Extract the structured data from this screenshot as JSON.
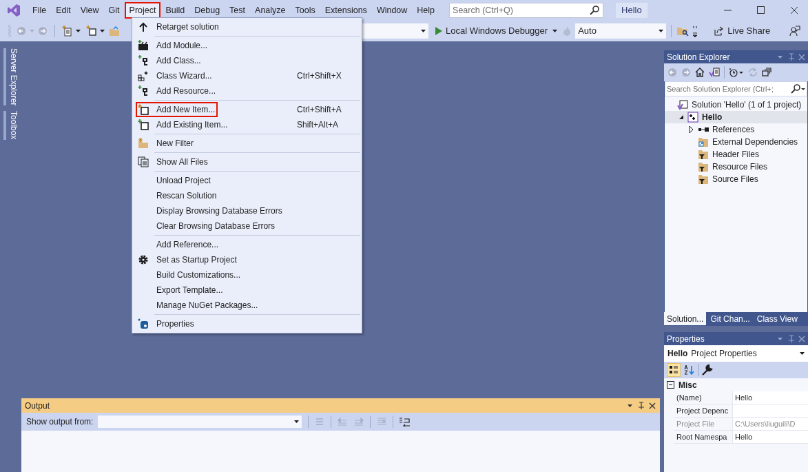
{
  "menu_bar": [
    {
      "label": "File",
      "selected": false
    },
    {
      "label": "Edit",
      "selected": false
    },
    {
      "label": "View",
      "selected": false
    },
    {
      "label": "Git",
      "selected": false
    },
    {
      "label": "Project",
      "selected": true
    },
    {
      "label": "Build",
      "selected": false
    },
    {
      "label": "Debug",
      "selected": false
    },
    {
      "label": "Test",
      "selected": false
    },
    {
      "label": "Analyze",
      "selected": false
    },
    {
      "label": "Tools",
      "selected": false
    },
    {
      "label": "Extensions",
      "selected": false
    },
    {
      "label": "Window",
      "selected": false
    },
    {
      "label": "Help",
      "selected": false
    }
  ],
  "search": {
    "placeholder": "Search (Ctrl+Q)"
  },
  "solution_badge": "Hello",
  "toolbar": {
    "debugger": "Local Windows Debugger",
    "configuration": "Auto",
    "live_share": "Live Share"
  },
  "side_tabs": [
    "Server Explorer",
    "Toolbox"
  ],
  "project_menu": {
    "groups": [
      [
        {
          "label": "Retarget solution",
          "outlined": false
        }
      ],
      [
        {
          "label": "Add Module...",
          "outlined": false
        },
        {
          "label": "Add Class...",
          "outlined": false
        },
        {
          "label": "Class Wizard...",
          "shortcut": "Ctrl+Shift+X",
          "outlined": false
        },
        {
          "label": "Add Resource...",
          "outlined": false
        }
      ],
      [
        {
          "label": "Add New Item...",
          "shortcut": "Ctrl+Shift+A",
          "outlined": true
        },
        {
          "label": "Add Existing Item...",
          "shortcut": "Shift+Alt+A",
          "outlined": false
        }
      ],
      [
        {
          "label": "New Filter",
          "outlined": false
        }
      ],
      [
        {
          "label": "Show All Files",
          "outlined": false
        }
      ],
      [
        {
          "label": "Unload Project",
          "outlined": false
        },
        {
          "label": "Rescan Solution",
          "outlined": false
        },
        {
          "label": "Display Browsing Database Errors",
          "outlined": false
        },
        {
          "label": "Clear Browsing Database Errors",
          "outlined": false
        }
      ],
      [
        {
          "label": "Add Reference...",
          "outlined": false
        },
        {
          "label": "Set as Startup Project",
          "outlined": false
        },
        {
          "label": "Build Customizations...",
          "outlined": false
        },
        {
          "label": "Export Template...",
          "outlined": false
        },
        {
          "label": "Manage NuGet Packages...",
          "outlined": false
        }
      ],
      [
        {
          "label": "Properties",
          "outlined": false
        }
      ]
    ]
  },
  "solution_explorer": {
    "title": "Solution Explorer",
    "search": {
      "placeholder": "Search Solution Explorer (Ctrl+;"
    },
    "tree": [
      {
        "label": "Solution 'Hello' (1 of 1 project)",
        "kind": "solution",
        "selected": false,
        "children": [
          {
            "label": "Hello",
            "kind": "project",
            "selected": true,
            "expanded": true,
            "children": [
              {
                "label": "References",
                "kind": "references",
                "selected": false,
                "expanded": false
              },
              {
                "label": "External Dependencies",
                "kind": "external",
                "selected": false
              },
              {
                "label": "Header Files",
                "kind": "filter",
                "selected": false
              },
              {
                "label": "Resource Files",
                "kind": "filter",
                "selected": false
              },
              {
                "label": "Source Files",
                "kind": "filter",
                "selected": false
              }
            ]
          }
        ]
      }
    ],
    "tabs": [
      {
        "label": "Solution...",
        "selected": true
      },
      {
        "label": "Git Chan...",
        "selected": false
      },
      {
        "label": "Class View",
        "selected": false
      }
    ]
  },
  "properties": {
    "title": "Properties",
    "object": "Hello",
    "object_type": "Project Properties",
    "categories": [
      {
        "name": "Misc",
        "expanded": true,
        "rows": [
          {
            "name": "(Name)",
            "value": "Hello",
            "disabled": false
          },
          {
            "name": "Project Depenc",
            "disabled": false
          },
          {
            "name": "Project File",
            "value": "C:\\Users\\liuguili\\D",
            "disabled": true
          },
          {
            "name": "Root Namespa",
            "value": "Hello",
            "disabled": false
          }
        ]
      }
    ]
  },
  "output": {
    "title": "Output",
    "source_label": "Show output from:"
  }
}
